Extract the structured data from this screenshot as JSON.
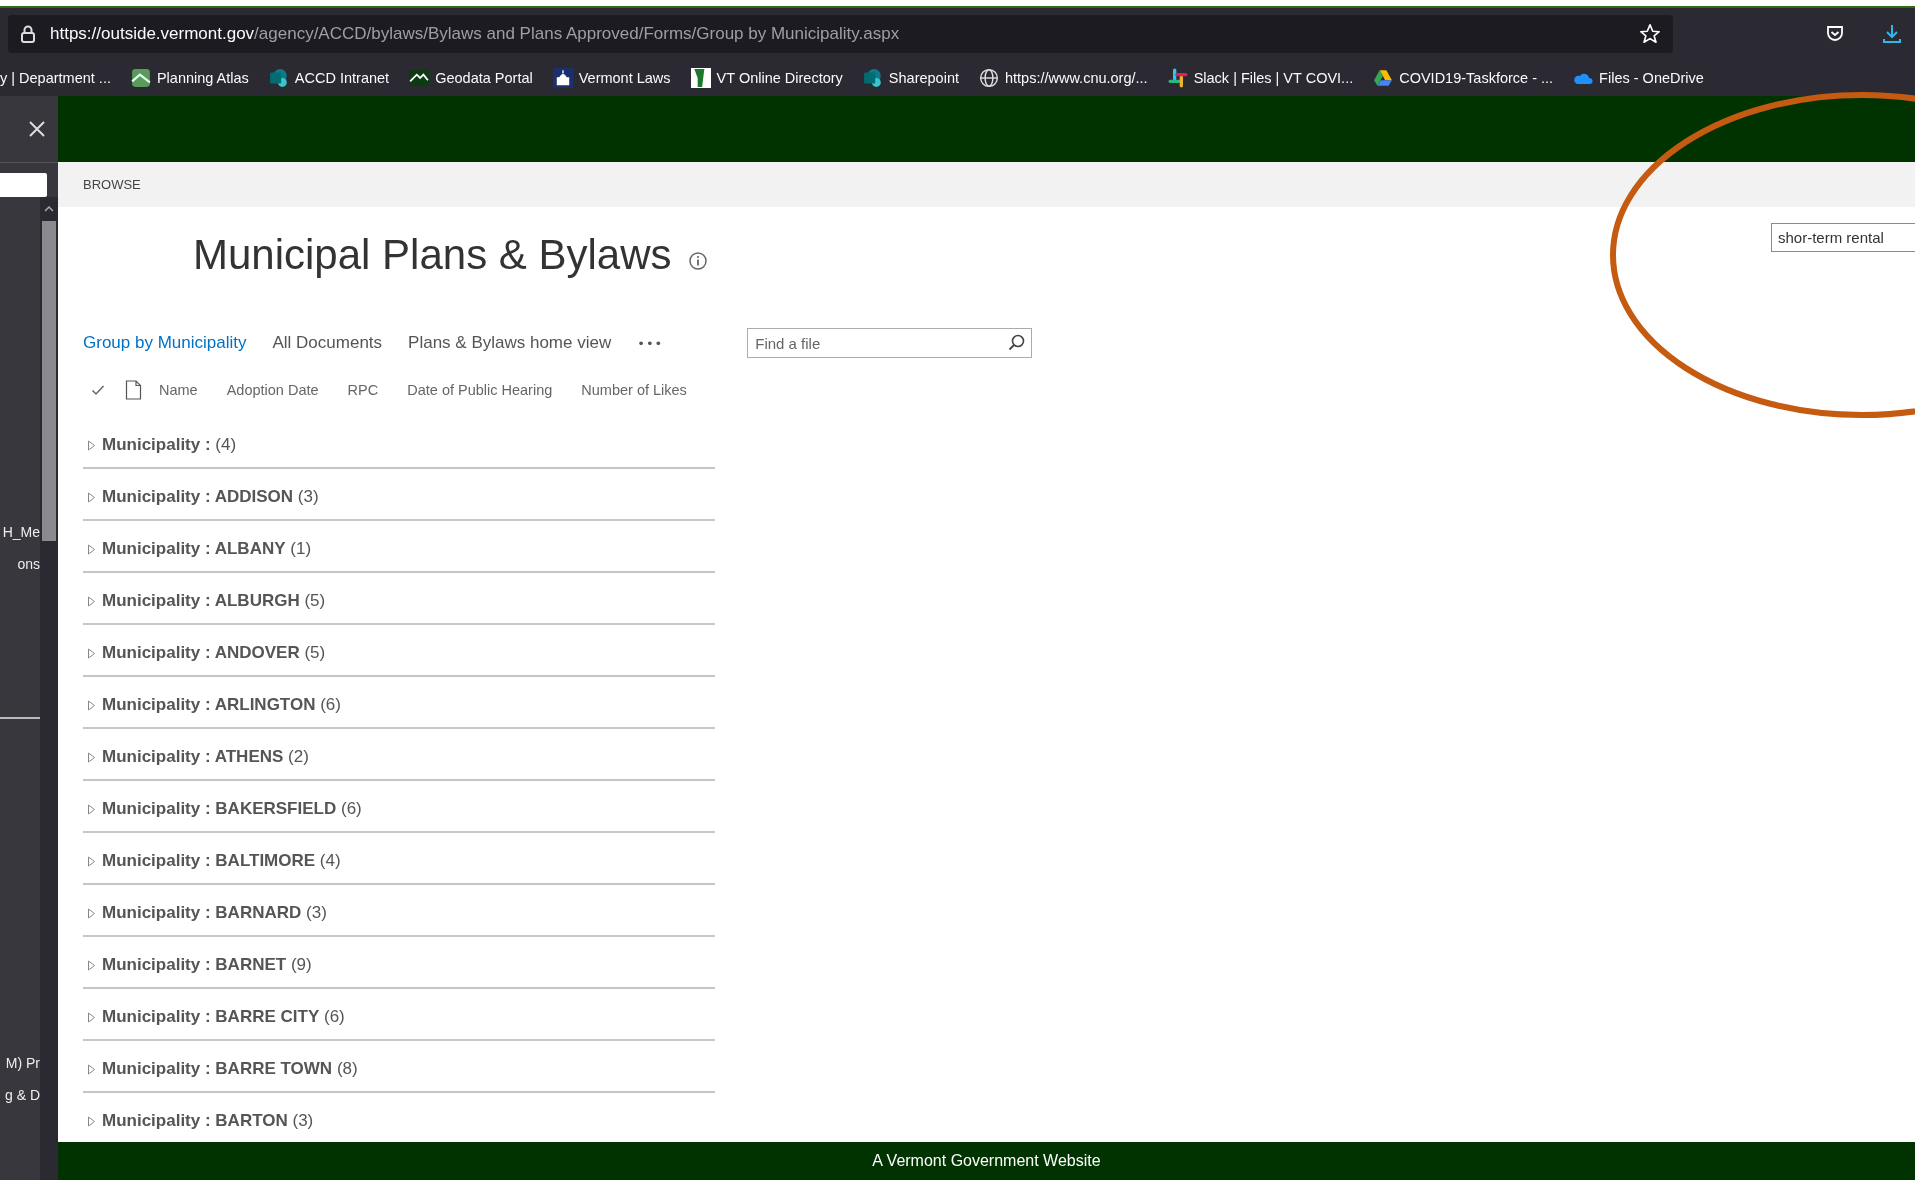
{
  "browser": {
    "url_host": "https://outside.vermont.gov",
    "url_path": "/agency/ACCD/bylaws/Bylaws and Plans Approved/Forms/Group by Municipality.aspx",
    "bookmarks": [
      {
        "label": "y | Department ...",
        "kind": "none"
      },
      {
        "label": "Planning Atlas",
        "kind": "geo"
      },
      {
        "label": "ACCD Intranet",
        "kind": "sharepoint"
      },
      {
        "label": "Geodata Portal",
        "kind": "mountain"
      },
      {
        "label": "Vermont Laws",
        "kind": "capitol"
      },
      {
        "label": "VT Online Directory",
        "kind": "state"
      },
      {
        "label": "Sharepoint",
        "kind": "sharepoint"
      },
      {
        "label": "https://www.cnu.org/...",
        "kind": "globe"
      },
      {
        "label": "Slack | Files | VT COVI...",
        "kind": "slack"
      },
      {
        "label": "COVID19-Taskforce - ...",
        "kind": "drive"
      },
      {
        "label": "Files - OneDrive",
        "kind": "cloud"
      }
    ]
  },
  "side_panel": {
    "texts": [
      "H_Me",
      "ons",
      "M) Pr",
      "g & D"
    ]
  },
  "ribbon": {
    "tab": "BROWSE"
  },
  "page": {
    "title": "Municipal Plans & Bylaws",
    "views": [
      {
        "label": "Group by Municipality",
        "selected": true
      },
      {
        "label": "All Documents",
        "selected": false
      },
      {
        "label": "Plans & Bylaws home view",
        "selected": false
      }
    ],
    "more": "•••",
    "find": {
      "placeholder": "Find a file"
    },
    "search": {
      "value": "shor-term rental"
    },
    "columns": [
      "Name",
      "Adoption Date",
      "RPC",
      "Date of Public Hearing",
      "Number of Likes"
    ],
    "groups": [
      {
        "label": "Municipality :",
        "count": "(4)"
      },
      {
        "label": "Municipality : ADDISON",
        "count": "(3)"
      },
      {
        "label": "Municipality : ALBANY",
        "count": "(1)"
      },
      {
        "label": "Municipality : ALBURGH",
        "count": "(5)"
      },
      {
        "label": "Municipality : ANDOVER",
        "count": "(5)"
      },
      {
        "label": "Municipality : ARLINGTON",
        "count": "(6)"
      },
      {
        "label": "Municipality : ATHENS",
        "count": "(2)"
      },
      {
        "label": "Municipality : BAKERSFIELD",
        "count": "(6)"
      },
      {
        "label": "Municipality : BALTIMORE",
        "count": "(4)"
      },
      {
        "label": "Municipality : BARNARD",
        "count": "(3)"
      },
      {
        "label": "Municipality : BARNET",
        "count": "(9)"
      },
      {
        "label": "Municipality : BARRE CITY",
        "count": "(6)"
      },
      {
        "label": "Municipality : BARRE TOWN",
        "count": "(8)"
      },
      {
        "label": "Municipality : BARTON",
        "count": "(3)"
      }
    ]
  },
  "footer": {
    "text": "A Vermont Government Website"
  }
}
